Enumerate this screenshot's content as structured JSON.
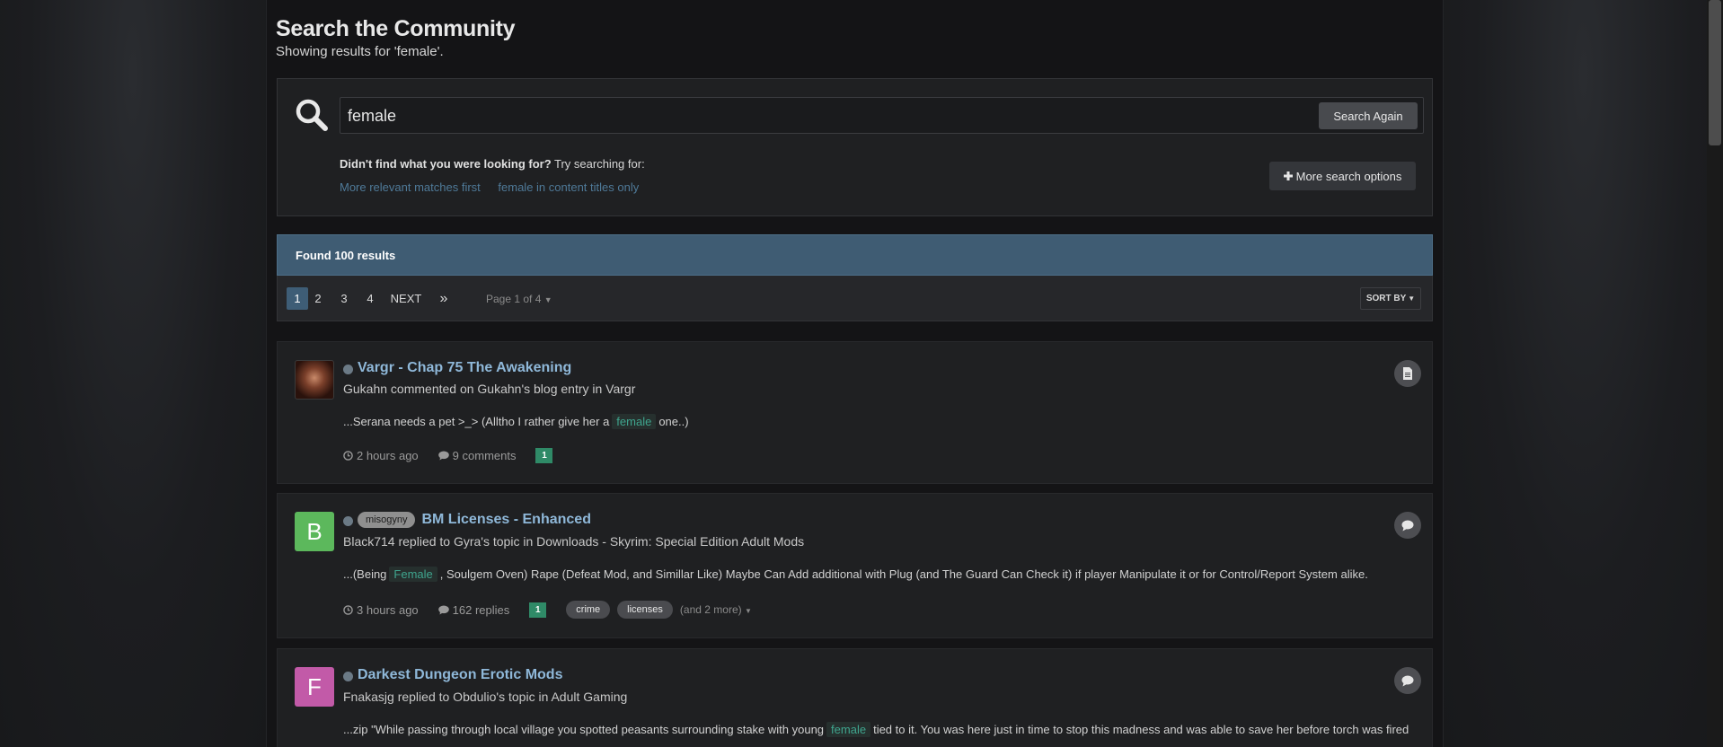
{
  "page": {
    "title": "Search the Community",
    "subtitle": "Showing results for 'female'."
  },
  "search": {
    "value": "female",
    "button_label": "Search Again",
    "didnt_find_bold": "Didn't find what you were looking for?",
    "didnt_find_rest": " Try searching for:",
    "suggestions": [
      "More relevant matches first",
      "female in content titles only"
    ],
    "more_options_label": "More search options"
  },
  "results_header": "Found 100 results",
  "pagination": {
    "pages": [
      "1",
      "2",
      "3",
      "4"
    ],
    "active_page": "1",
    "next_label": "NEXT",
    "last_label": "»",
    "page_of": "Page 1 of 4",
    "sort_label": "SORT BY"
  },
  "results": [
    {
      "title": "Vargr - Chap 75 The Awakening",
      "meta": "Gukahn commented on Gukahn's blog entry in Vargr",
      "snippet_before": "...Serana needs a pet >_> (Alltho I rather give her a",
      "snippet_highlight": "female",
      "snippet_after": "one..)",
      "time": "2 hours ago",
      "count": "9 comments",
      "reputation": "1",
      "type_icon": "document-icon"
    },
    {
      "avatar_letter": "B",
      "avatar_color": "#5cb85c",
      "prefix": "misogyny",
      "title": "BM Licenses - Enhanced",
      "meta": "Black714 replied to Gyra's topic in Downloads - Skyrim: Special Edition Adult Mods",
      "snippet_before": "...(Being",
      "snippet_highlight": "Female",
      "snippet_after": ", Soulgem Oven) Rape (Defeat Mod, and Simillar Like) Maybe Can Add additional with Plug (and The Guard Can Check it) if player Manipulate it or for Control/Report System alike.",
      "time": "3 hours ago",
      "count": "162 replies",
      "reputation": "1",
      "tags": [
        "crime",
        "licenses"
      ],
      "more_tags": "(and 2 more)",
      "type_icon": "comment-icon"
    },
    {
      "avatar_letter": "F",
      "avatar_color": "#c25aa8",
      "title": "Darkest Dungeon Erotic Mods",
      "meta": "Fnakasjg replied to Obdulio's topic in Adult Gaming",
      "snippet_before": "...zip \"While passing through local village you spotted peasants surrounding stake with young",
      "snippet_highlight": "female",
      "snippet_after": "tied to it. You was here just in time to stop this madness and was able to save her before torch was fired",
      "type_icon": "comment-icon"
    }
  ],
  "colors": {
    "accent": "#3f5c73",
    "link": "#8fb8d9",
    "highlight": "#3fa58e",
    "reputation": "#2f8a67"
  }
}
